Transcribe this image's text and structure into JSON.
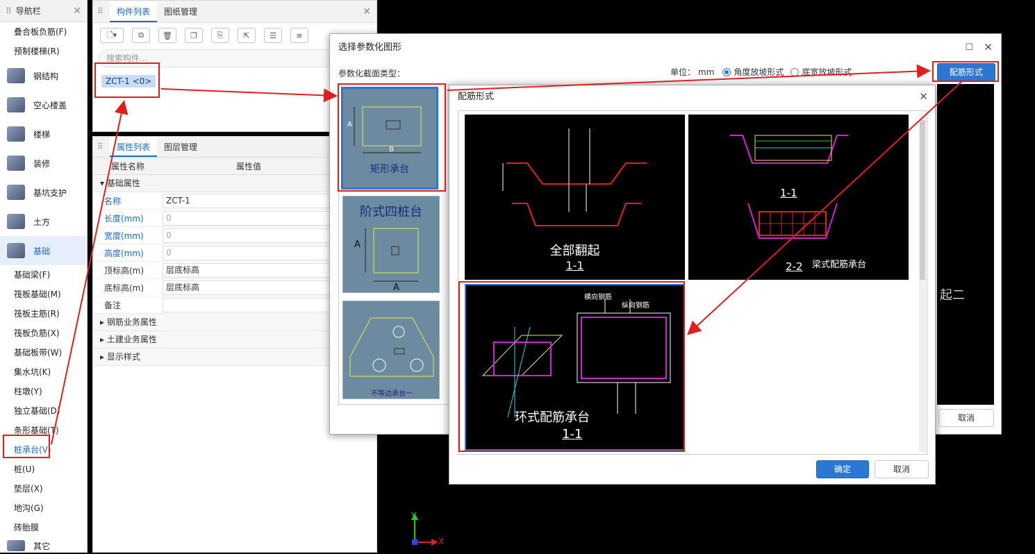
{
  "nav": {
    "title": "导航栏",
    "top_items": [
      "叠合板负筋(F)",
      "预制楼梯(R)"
    ],
    "categories": [
      "钢结构",
      "空心楼盖",
      "楼梯",
      "装修",
      "基坑支护",
      "土方",
      "基础"
    ],
    "sub_items": [
      "基础梁(F)",
      "筏板基础(M)",
      "筏板主筋(R)",
      "筏板负筋(X)",
      "基础板带(W)",
      "集水坑(K)",
      "柱墩(Y)",
      "独立基础(D)",
      "条形基础(T)",
      "桩承台(V)",
      "桩(U)",
      "垫层(X)",
      "地沟(G)",
      "砖胎膜"
    ],
    "bottom_item": "其它"
  },
  "component_panel": {
    "tabs": [
      "构件列表",
      "图纸管理"
    ],
    "search_placeholder": "搜索构件...",
    "item": "ZCT-1 <0>"
  },
  "property_panel": {
    "tabs": [
      "属性列表",
      "图层管理"
    ],
    "col_name": "属性名称",
    "col_value": "属性值",
    "group_basic": "基础属性",
    "rows": [
      {
        "k": "名称",
        "v": "ZCT-1"
      },
      {
        "k": "长度(mm)",
        "v": "0"
      },
      {
        "k": "宽度(mm)",
        "v": "0"
      },
      {
        "k": "高度(mm)",
        "v": "0"
      },
      {
        "k": "顶标高(m)",
        "v": "层底标高"
      },
      {
        "k": "底标高(m)",
        "v": "层底标高"
      },
      {
        "k": "备注",
        "v": ""
      }
    ],
    "groups": [
      "钢筋业务属性",
      "土建业务属性",
      "显示样式"
    ]
  },
  "dialog_param": {
    "title": "选择参数化图形",
    "section_label": "参数化截面类型：",
    "unit_label": "单位：",
    "unit": "mm",
    "radio1": "角度放坡形式",
    "radio2": "底宽放坡形式",
    "rebar_button": "配筋形式",
    "cancel": "取消",
    "thumb1": "矩形承台",
    "thumb1_a": "A",
    "thumb1_b": "B",
    "thumb2": "阶式四桩台",
    "thumb2_a": "A",
    "thumb3": "不等边承台一",
    "right_label": "起二"
  },
  "dialog_rebar": {
    "title": "配筋形式",
    "cell1_title": "全部翻起",
    "cell1_sec": "1-1",
    "cell2_sec1": "1-1",
    "cell2_sec2": "2-2",
    "cell2_title": "梁式配筋承台",
    "cell3_title": "环式配筋承台",
    "cell3_sec": "1-1",
    "cell3_label_x": "横向钢筋",
    "cell3_label_y": "纵向钢筋",
    "ok": "确定",
    "cancel": "取消"
  },
  "axis": {
    "y": "Y",
    "x": "X"
  },
  "colors": {
    "accent": "#1e68c8",
    "annotation": "#e21d1d",
    "thumb_bg": "#6c8aa0"
  }
}
